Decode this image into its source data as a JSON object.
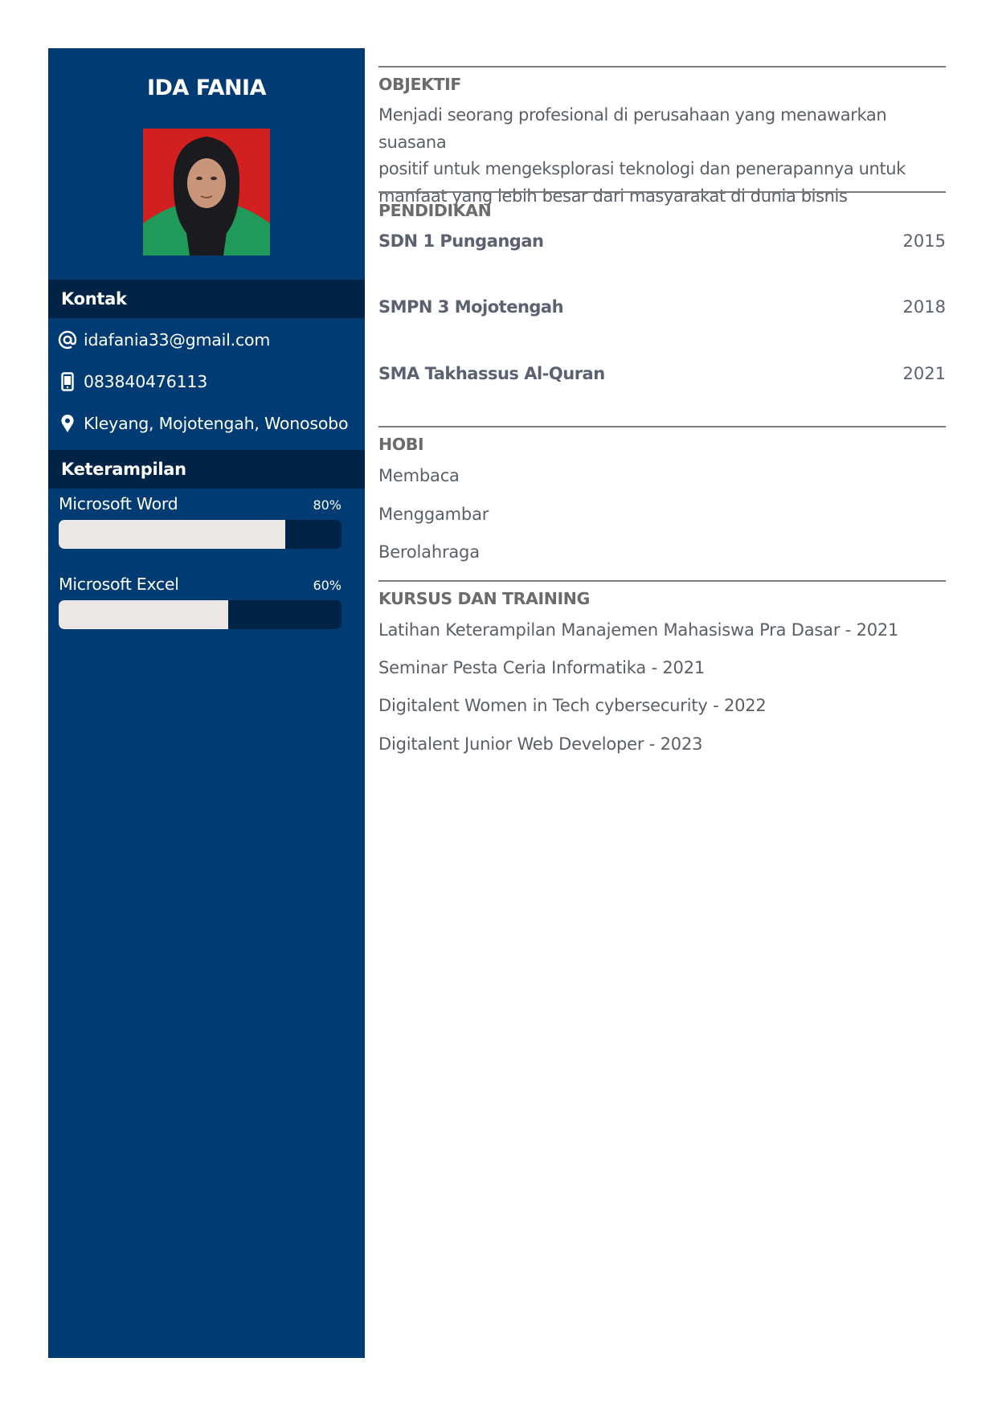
{
  "sidebar": {
    "name": "IDA FANIA",
    "contact_header": "Kontak",
    "contacts": [
      {
        "icon": "at-icon",
        "text": "idafania33@gmail.com"
      },
      {
        "icon": "phone-icon",
        "text": "083840476113"
      },
      {
        "icon": "location-pin-icon",
        "text": "Kleyang, Mojotengah, Wonosobo"
      }
    ],
    "skills_header": "Keterampilan",
    "skills": [
      {
        "name": "Microsoft Word",
        "percent_label": "80%",
        "level": 0.8
      },
      {
        "name": "Microsoft Excel",
        "percent_label": "60%",
        "level": 0.6
      }
    ]
  },
  "main": {
    "objective": {
      "heading": "OBJEKTIF",
      "lines": [
        "Menjadi seorang profesional di perusahaan yang menawarkan suasana",
        "positif untuk mengeksplorasi teknologi dan penerapannya untuk",
        "manfaat yang lebih besar dari masyarakat di dunia bisnis"
      ]
    },
    "education": {
      "heading": "PENDIDIKAN",
      "items": [
        {
          "school": "SDN 1 Pungangan",
          "year": "2015"
        },
        {
          "school": "SMPN 3 Mojotengah",
          "year": "2018"
        },
        {
          "school": "SMA Takhassus Al-Quran",
          "year": "2021"
        }
      ]
    },
    "hobbies": {
      "heading": "HOBI",
      "items": [
        "Membaca",
        "Menggambar",
        "Berolahraga"
      ]
    },
    "courses": {
      "heading": "KURSUS DAN TRAINING",
      "items": [
        "Latihan Keterampilan Manajemen Mahasiswa Pra Dasar - 2021",
        "Seminar Pesta Ceria Informatika - 2021",
        "Digitalent Women in Tech cybersecurity - 2022",
        "Digitalent Junior Web Developer - 2023"
      ]
    }
  },
  "colors": {
    "sidebar_bg": "#003b74",
    "sidebar_header_bg": "#012446",
    "bar_fill": "#ebe7e4",
    "text_grey": "#5a5e66"
  }
}
